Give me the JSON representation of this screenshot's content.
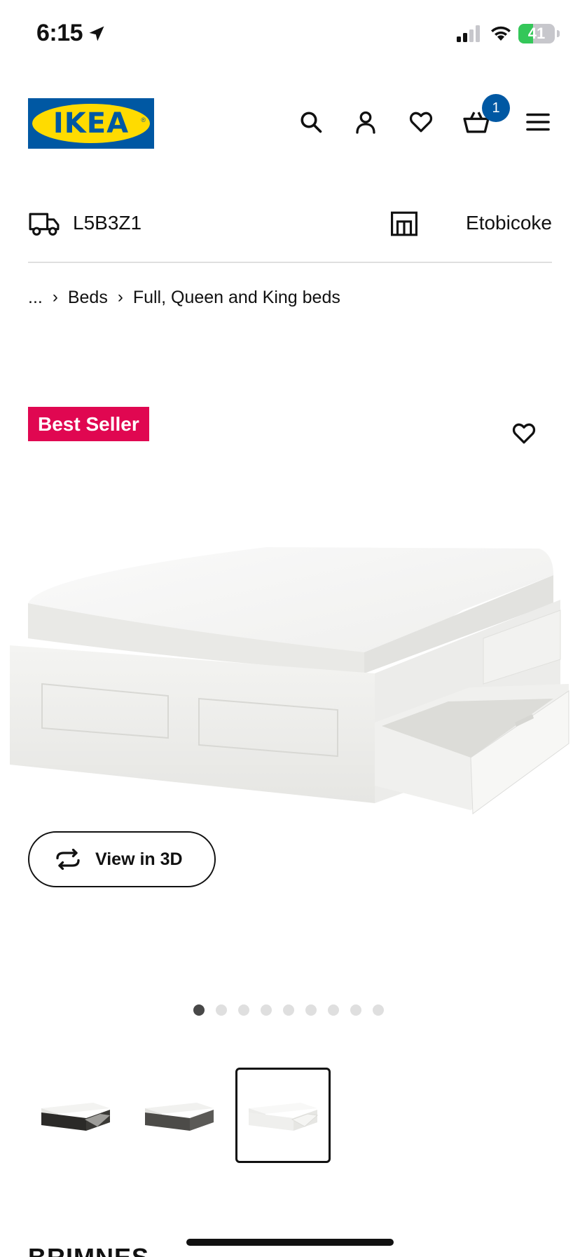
{
  "status_bar": {
    "time": "6:15",
    "battery_percent": "41",
    "battery_level": 0.41
  },
  "header": {
    "logo_text": "IKEA",
    "cart_count": "1"
  },
  "delivery": {
    "postcode": "L5B3Z1",
    "store": "Etobicoke"
  },
  "breadcrumb": {
    "ellipsis": "...",
    "items": [
      "Beds",
      "Full, Queen and King beds"
    ]
  },
  "product": {
    "badge": "Best Seller",
    "view_3d_label": "View in 3D",
    "title_partial": "BRIMNES",
    "carousel_total": 9,
    "carousel_active": 1,
    "thumbnail_count": 3,
    "thumbnail_selected": 3
  },
  "colors": {
    "ikea_blue": "#0058a3",
    "ikea_yellow": "#ffdb00",
    "badge_red": "#e00751"
  }
}
